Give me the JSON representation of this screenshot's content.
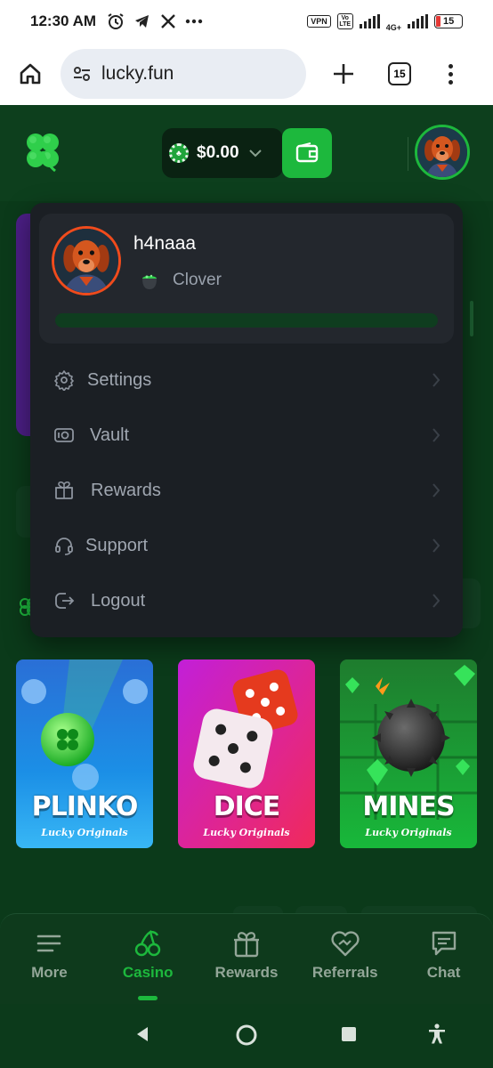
{
  "status_bar": {
    "time": "12:30 AM",
    "icons": [
      "alarm-icon",
      "telegram-icon",
      "x-icon",
      "more-icon"
    ],
    "vpn_label": "VPN",
    "volte_label": "Vo LTE",
    "network_label": "4G+",
    "battery_level": "15"
  },
  "browser": {
    "url": "lucky.fun",
    "tab_count": "15"
  },
  "header": {
    "balance": "$0.00",
    "accent_color": "#1db83d"
  },
  "dropdown": {
    "username": "h4naaa",
    "rank": "Clover",
    "progress": 0,
    "items": [
      {
        "label": "Settings",
        "icon": "gear-icon"
      },
      {
        "label": "Vault",
        "icon": "vault-icon"
      },
      {
        "label": "Rewards",
        "icon": "gift-icon"
      },
      {
        "label": "Support",
        "icon": "headset-icon"
      },
      {
        "label": "Logout",
        "icon": "logout-icon"
      }
    ]
  },
  "games": [
    {
      "title": "PLINKO",
      "subtitle": "Lucky Originals"
    },
    {
      "title": "DICE",
      "subtitle": "Lucky Originals"
    },
    {
      "title": "MINES",
      "subtitle": "Lucky Originals"
    }
  ],
  "bottom_nav": {
    "items": [
      {
        "label": "More",
        "icon": "menu-icon"
      },
      {
        "label": "Casino",
        "icon": "cherries-icon",
        "active": true
      },
      {
        "label": "Rewards",
        "icon": "gift-icon"
      },
      {
        "label": "Referrals",
        "icon": "handshake-heart-icon"
      },
      {
        "label": "Chat",
        "icon": "chat-icon"
      }
    ]
  }
}
